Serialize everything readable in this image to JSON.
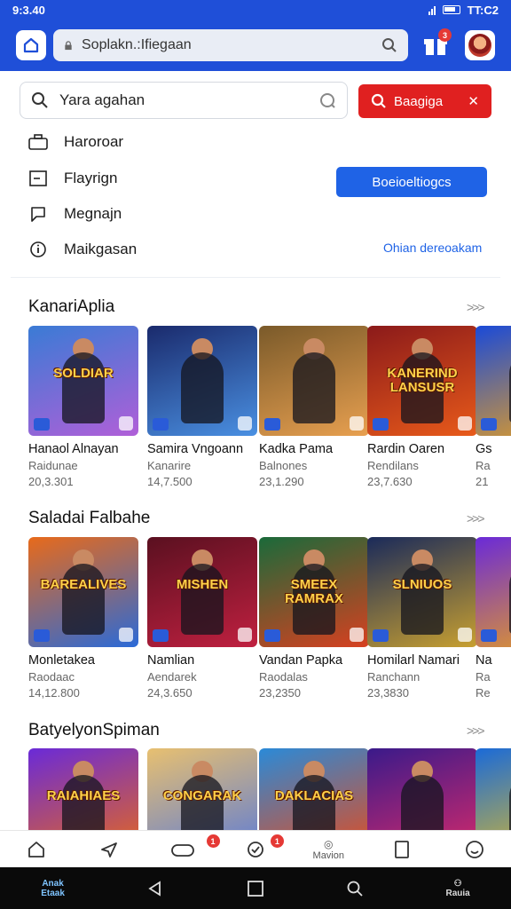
{
  "status": {
    "time": "9:3.40",
    "right_time": "TT:C2"
  },
  "browser": {
    "url_text": "Soplakn.:Ifiegaan",
    "gift_badge": "3"
  },
  "search": {
    "query": "Yara agahan",
    "button_label": "Baagiga"
  },
  "menu": [
    {
      "label": "Haroroar",
      "icon": "briefcase-icon"
    },
    {
      "label": "Flayrign",
      "icon": "card-icon"
    },
    {
      "label": "Megnajn",
      "icon": "chat-icon"
    },
    {
      "label": "Maikgasan",
      "icon": "info-icon"
    }
  ],
  "blue_button": "Boeioeltiogcs",
  "link_text": "Ohian dereoakam",
  "more": ">>>",
  "sections": [
    {
      "title": "KanariAplia",
      "cards": [
        {
          "name": "Hanaol Alnayan",
          "sub": "Raidunae",
          "count": "20,3.301",
          "art": "SOLDIAR",
          "c1": "#3a7bd5",
          "c2": "#b05fd8"
        },
        {
          "name": "Samira Vngoann",
          "sub": "Kanarire",
          "count": "14,7.500",
          "art": "",
          "c1": "#1a2a6c",
          "c2": "#4a90e2"
        },
        {
          "name": "Kadka Pama",
          "sub": "Balnones",
          "count": "23,1.290",
          "art": "",
          "c1": "#7a5a2a",
          "c2": "#e8a050"
        },
        {
          "name": "Rardin Oaren",
          "sub": "Rendilans",
          "count": "23,7.630",
          "art": "KANERIND LANSUSR",
          "c1": "#8b1a1a",
          "c2": "#e85a1a"
        },
        {
          "name": "Gs",
          "sub": "Ra",
          "count": "21",
          "art": "",
          "c1": "#1a4ad8",
          "c2": "#e8a020"
        }
      ]
    },
    {
      "title": "Saladai Falbahe",
      "cards": [
        {
          "name": "Monletakea",
          "sub": "Raodaac",
          "count": "14,12.800",
          "art": "BAREALIVES",
          "c1": "#e86a1a",
          "c2": "#2a6ad8"
        },
        {
          "name": "Namlian",
          "sub": "Aendarek",
          "count": "24,3.650",
          "art": "MISHEN",
          "c1": "#5a1020",
          "c2": "#c02040"
        },
        {
          "name": "Vandan Papka",
          "sub": "Raodalas",
          "count": "23,2350",
          "art": "SMEEX RAMRAX",
          "c1": "#1a6a3a",
          "c2": "#d84020"
        },
        {
          "name": "Homilarl Namari",
          "sub": "Ranchann",
          "count": "23,3830",
          "art": "SLNIUOS",
          "c1": "#1a2a5a",
          "c2": "#c8a030"
        },
        {
          "name": "Na",
          "sub": "Ra",
          "count": "Re",
          "art": "",
          "c1": "#6a2ad8",
          "c2": "#e8a020"
        }
      ]
    },
    {
      "title": "BatyelyonSpiman",
      "cards": [
        {
          "name": "",
          "sub": "",
          "count": "",
          "art": "RAIAHIAES",
          "c1": "#6a2ad8",
          "c2": "#e86a1a"
        },
        {
          "name": "",
          "sub": "",
          "count": "",
          "art": "CONGARAK",
          "c1": "#e8c070",
          "c2": "#5a7ad8"
        },
        {
          "name": "",
          "sub": "",
          "count": "",
          "art": "DAKLACIAS",
          "c1": "#2a8ad8",
          "c2": "#e84a1a"
        },
        {
          "name": "",
          "sub": "",
          "count": "",
          "art": "",
          "c1": "#3a1a8a",
          "c2": "#d82a6a"
        },
        {
          "name": "",
          "sub": "",
          "count": "",
          "art": "",
          "c1": "#1a6ad8",
          "c2": "#e8c020"
        }
      ]
    }
  ],
  "bottom_nav": {
    "badge_a": "1",
    "badge_b": "1",
    "rewards_label": "Mavion"
  },
  "system_nav": {
    "apps_label_1": "Anak",
    "apps_label_2": "Etaak",
    "right_label": "Rauia"
  }
}
